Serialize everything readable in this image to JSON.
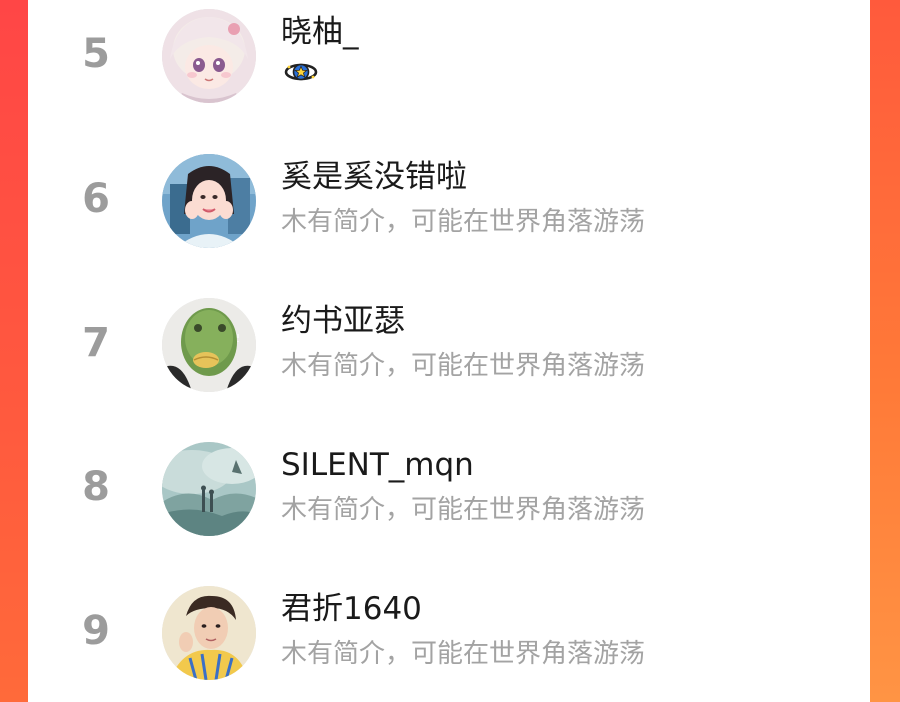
{
  "ranking": {
    "rows": [
      {
        "rank": "5",
        "name": "晓柚_",
        "bio": "",
        "badge_icon": "star-planet-badge-icon",
        "avatar_icon": "anime-girl-avatar-icon"
      },
      {
        "rank": "6",
        "name": "奚是奚没错啦",
        "bio": "木有简介，可能在世界角落游荡",
        "avatar_icon": "woman-selfie-avatar-icon"
      },
      {
        "rank": "7",
        "name": "约书亚瑟",
        "bio": "木有简介，可能在世界角落游荡",
        "avatar_icon": "fish-head-avatar-icon"
      },
      {
        "rank": "8",
        "name": "SILENT_mqn",
        "bio": "木有简介，可能在世界角落游荡",
        "avatar_icon": "misty-landscape-avatar-icon"
      },
      {
        "rank": "9",
        "name": "君折1640",
        "bio": "木有简介，可能在世界角落游荡",
        "avatar_icon": "man-portrait-avatar-icon"
      }
    ]
  },
  "colors": {
    "accent_left": "#ff4646",
    "accent_right": "#ff8a3b",
    "rank_number": "#9c9c9c",
    "name_text": "#1a1a1a",
    "bio_text": "#a3a3a3"
  }
}
